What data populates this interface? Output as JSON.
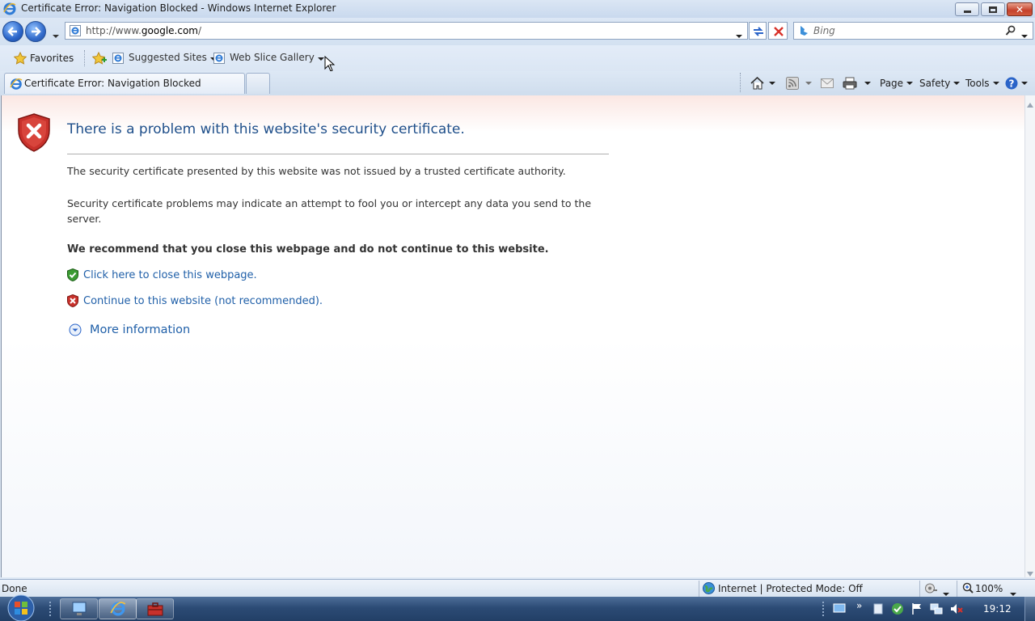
{
  "window": {
    "title": "Certificate Error: Navigation Blocked - Windows Internet Explorer"
  },
  "address_bar": {
    "url_prefix": "http://www.",
    "url_domain": "google.com",
    "url_suffix": "/"
  },
  "search": {
    "placeholder": "Bing"
  },
  "favorites_bar": {
    "favorites_label": "Favorites",
    "items": [
      {
        "label": "Suggested Sites"
      },
      {
        "label": "Web Slice Gallery"
      }
    ]
  },
  "tabs": [
    {
      "label": "Certificate Error: Navigation Blocked"
    }
  ],
  "command_bar": {
    "page_label": "Page",
    "safety_label": "Safety",
    "tools_label": "Tools"
  },
  "page": {
    "heading": "There is a problem with this website's security certificate.",
    "paragraph1": "The security certificate presented by this website was not issued by a trusted certificate authority.",
    "paragraph2": "Security certificate problems may indicate an attempt to fool you or intercept any data you send to the server.",
    "recommendation": "We recommend that you close this webpage and do not continue to this website.",
    "close_link": "Click here to close this webpage.",
    "continue_link": "Continue to this website (not recommended).",
    "more_info": "More information"
  },
  "status_bar": {
    "status": "Done",
    "zone": "Internet | Protected Mode: Off",
    "zoom": "100%"
  },
  "taskbar": {
    "clock": "19:12"
  },
  "colors": {
    "heading": "#1f4f8a",
    "link": "#1f5fa8",
    "error_red": "#c8312b",
    "ok_green": "#3b9b32"
  }
}
